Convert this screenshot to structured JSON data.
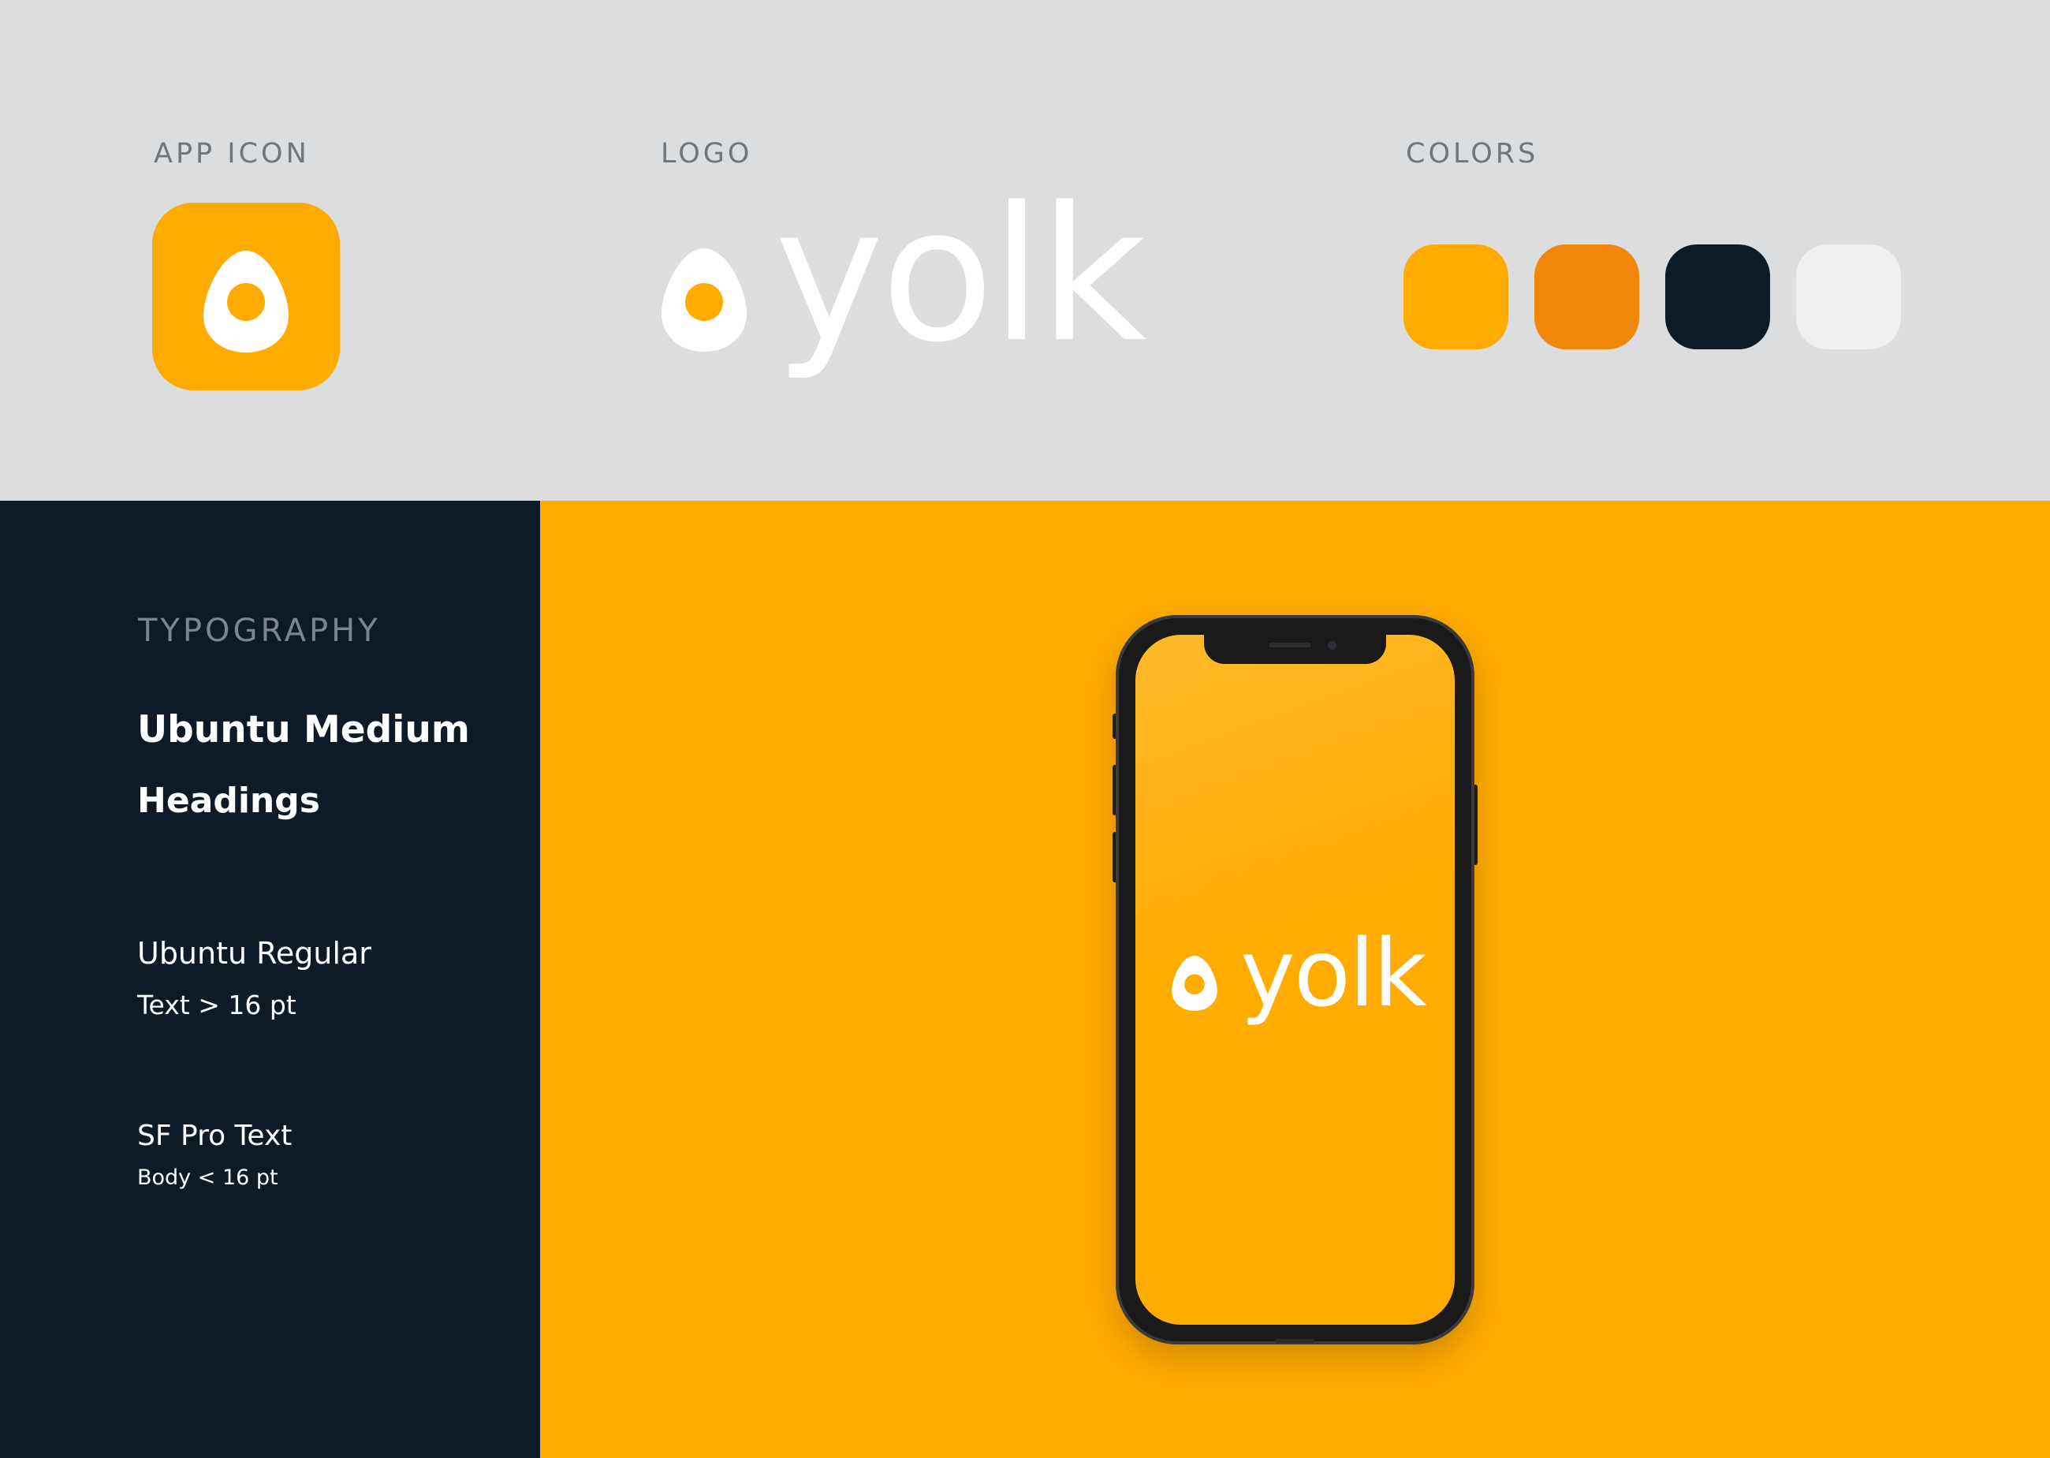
{
  "sections": {
    "app_icon_label": "APP ICON",
    "logo_label": "LOGO",
    "colors_label": "COLORS",
    "typography_label": "TYPOGRAPHY"
  },
  "logo": {
    "wordmark": "yolk",
    "icon": "egg-icon"
  },
  "colors": [
    "#FFAB00",
    "#F0870A",
    "#0E1B27",
    "#F0F0F0"
  ],
  "typography": {
    "heading_font": "Ubuntu Medium",
    "heading_use": "Headings",
    "text_font": "Ubuntu Regular",
    "text_use": "Text > 16 pt",
    "body_font": "SF Pro Text",
    "body_use": "Body < 16 pt"
  },
  "mockup": {
    "device": "phone",
    "screen_wordmark": "yolk"
  }
}
